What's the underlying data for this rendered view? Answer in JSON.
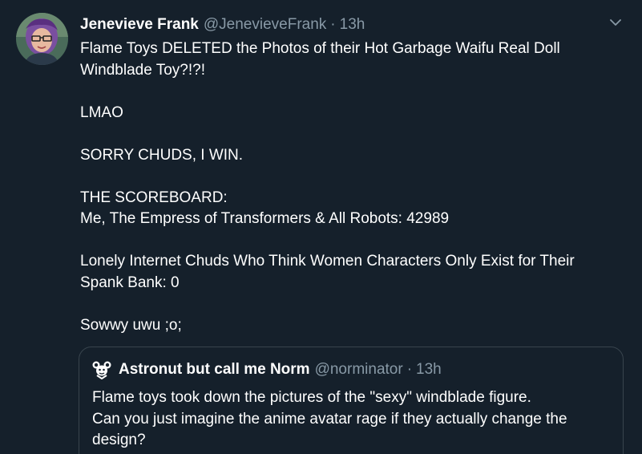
{
  "tweet": {
    "author_name": "Jenevieve Frank",
    "author_handle": "@JenevieveFrank",
    "separator": "·",
    "time": "13h",
    "avatar_icon": "user-avatar-photo",
    "menu_icon": "chevron-down-icon",
    "lines": {
      "l1": "Flame Toys DELETED the Photos of their Hot Garbage Waifu Real Doll",
      "l2": "Windblade Toy?!?!",
      "l3": "LMAO",
      "l4": "SORRY CHUDS, I WIN.",
      "l5": "THE SCOREBOARD:",
      "l6": "Me, The Empress of Transformers & All Robots: 42989",
      "l7": "Lonely Internet Chuds Who Think Women Characters Only Exist for Their",
      "l8": "Spank Bank: 0",
      "l9": "Sowwy uwu ;o;"
    }
  },
  "quoted_tweet": {
    "author_name": "Astronut but call me Norm",
    "author_handle": "@norminator",
    "separator": "·",
    "time": "13h",
    "avatar_icon": "cartoon-mouse-avatar",
    "lines": {
      "l1": "Flame toys took down the pictures of the \"sexy\" windblade figure.",
      "l2": "Can you just imagine the anime avatar rage if they actually change the",
      "l3": "design?"
    }
  },
  "colors": {
    "background": "#15202b",
    "text_primary": "#ffffff",
    "text_secondary": "#8899a6",
    "border": "#38444d"
  }
}
